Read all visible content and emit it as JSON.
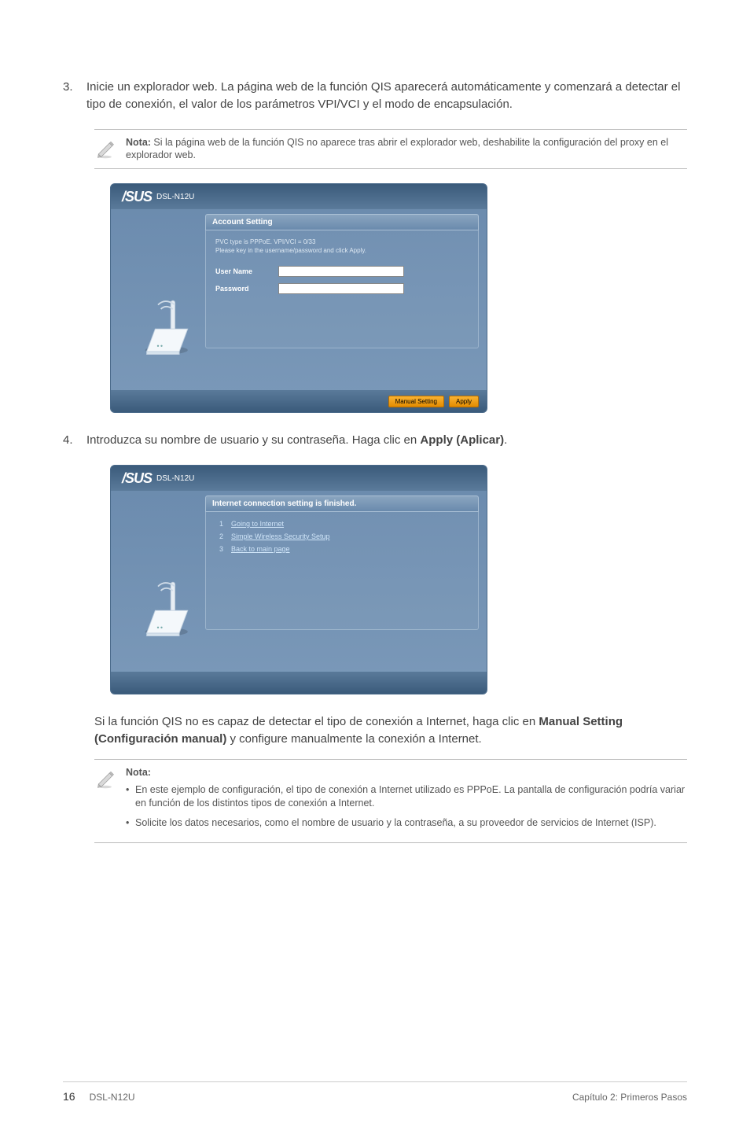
{
  "steps": {
    "s3": {
      "num": "3.",
      "text": "Inicie un explorador web. La página web de la función QIS aparecerá automáticamente y comenzará a detectar el tipo de conexión, el valor de los parámetros VPI/VCI y el modo de encapsulación."
    },
    "s4": {
      "num": "4.",
      "prefix": "Introduzca su nombre de usuario y su contraseña. Haga clic en ",
      "bold": "Apply (Aplicar)",
      "suffix": "."
    }
  },
  "note1": {
    "bold": "Nota:",
    "text": " Si la página web de la función QIS no aparece tras abrir el explorador web, deshabilite la configuración del proxy en el explorador web."
  },
  "shot1": {
    "brand": "/SUS",
    "model": "DSL-N12U",
    "panel_title": "Account Setting",
    "sub1": "PVC type is PPPoE. VPI/VCI = 0/33",
    "sub2": "Please key in the username/password and click Apply.",
    "user_name_label": "User Name",
    "password_label": "Password",
    "btn_manual": "Manual Setting",
    "btn_apply": "Apply"
  },
  "shot2": {
    "brand": "/SUS",
    "model": "DSL-N12U",
    "panel_title": "Internet connection setting is finished.",
    "links": [
      {
        "n": "1",
        "t": "Going to Internet"
      },
      {
        "n": "2",
        "t": "Simple Wireless Security Setup"
      },
      {
        "n": "3",
        "t": "Back to main page"
      }
    ]
  },
  "para_qis": {
    "pre": "Si la función QIS no es capaz de detectar el tipo de conexión a Internet, haga clic en ",
    "bold": "Manual Setting (Configuración manual)",
    "post": " y configure manualmente la conexión a Internet."
  },
  "note2": {
    "heading": "Nota:",
    "items": [
      "En este ejemplo de configuración, el tipo de conexión a Internet utilizado es PPPoE. La pantalla de configuración podría variar en función de los distintos tipos de conexión a Internet.",
      "Solicite los datos necesarios, como el nombre de usuario y la contraseña, a su proveedor de servicios de Internet (ISP)."
    ]
  },
  "footer": {
    "page": "16",
    "model": "DSL-N12U",
    "chapter": "Capítulo 2: Primeros Pasos"
  }
}
